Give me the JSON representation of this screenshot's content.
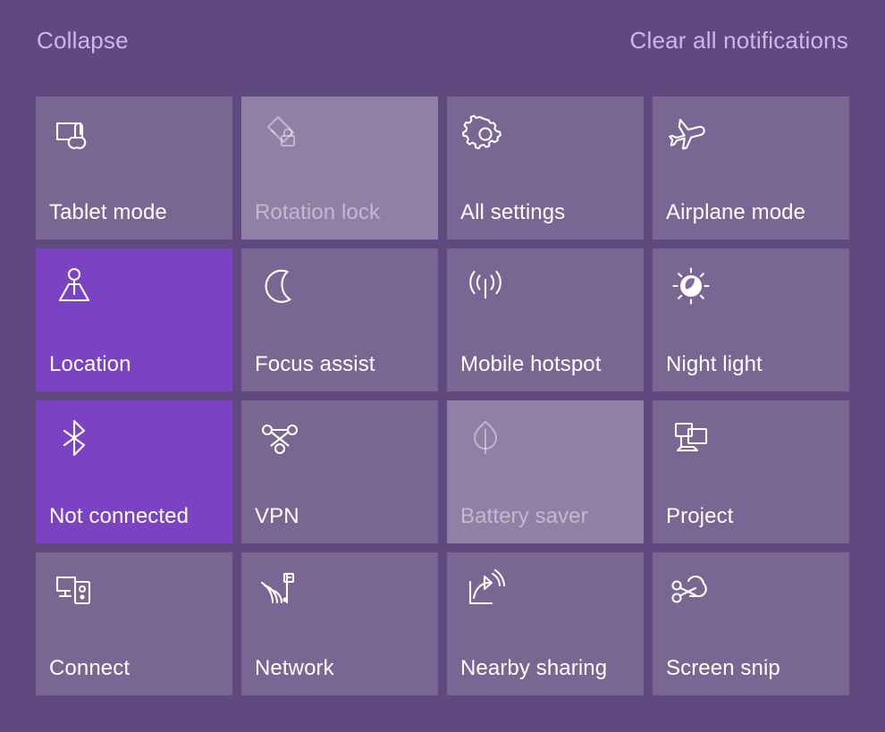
{
  "header": {
    "collapse_label": "Collapse",
    "clear_label": "Clear all notifications"
  },
  "colors": {
    "background": "#60497f",
    "tile_active": "#7b43c4",
    "tile_inactive": "rgba(255,255,255,0.16)",
    "tile_disabled": "rgba(255,255,255,0.30)",
    "label": "#ffffff",
    "label_disabled": "rgba(255,255,255,0.45)",
    "header_link": "#cbb8e8"
  },
  "tiles": [
    {
      "label": "Tablet mode",
      "icon": "tablet-mode-icon",
      "state": "inactive"
    },
    {
      "label": "Rotation lock",
      "icon": "rotation-lock-icon",
      "state": "disabled"
    },
    {
      "label": "All settings",
      "icon": "gear-icon",
      "state": "inactive"
    },
    {
      "label": "Airplane mode",
      "icon": "airplane-icon",
      "state": "inactive"
    },
    {
      "label": "Location",
      "icon": "location-icon",
      "state": "active"
    },
    {
      "label": "Focus assist",
      "icon": "moon-icon",
      "state": "inactive"
    },
    {
      "label": "Mobile hotspot",
      "icon": "hotspot-icon",
      "state": "inactive"
    },
    {
      "label": "Night light",
      "icon": "night-light-icon",
      "state": "inactive"
    },
    {
      "label": "Not connected",
      "icon": "bluetooth-icon",
      "state": "active"
    },
    {
      "label": "VPN",
      "icon": "vpn-icon",
      "state": "inactive"
    },
    {
      "label": "Battery saver",
      "icon": "leaf-icon",
      "state": "disabled"
    },
    {
      "label": "Project",
      "icon": "project-icon",
      "state": "inactive"
    },
    {
      "label": "Connect",
      "icon": "connect-icon",
      "state": "inactive"
    },
    {
      "label": "Network",
      "icon": "network-icon",
      "state": "inactive"
    },
    {
      "label": "Nearby sharing",
      "icon": "nearby-sharing-icon",
      "state": "inactive"
    },
    {
      "label": "Screen snip",
      "icon": "screen-snip-icon",
      "state": "inactive"
    }
  ]
}
